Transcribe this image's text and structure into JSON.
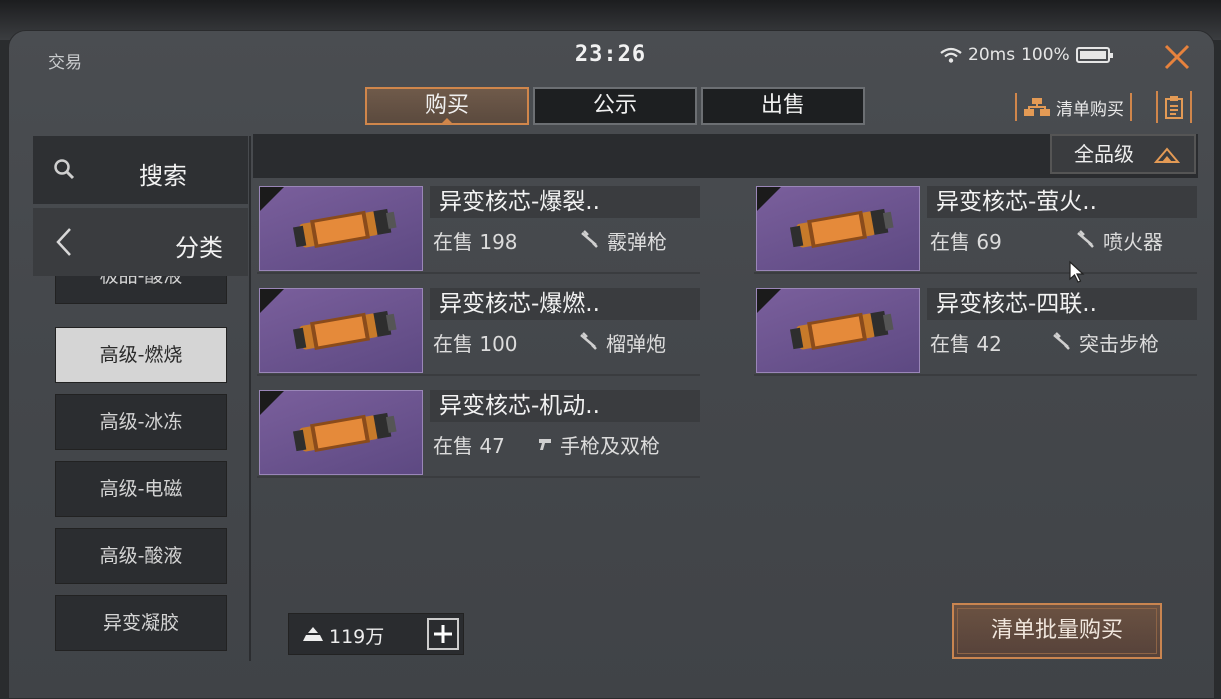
{
  "status": {
    "app_label": "交易",
    "time": "23:26",
    "network": "20ms",
    "battery": "100%"
  },
  "tabs": [
    {
      "label": "购买",
      "active": true
    },
    {
      "label": "公示",
      "active": false
    },
    {
      "label": "出售",
      "active": false
    }
  ],
  "toolbar": {
    "list_buy_label": "清单购买"
  },
  "sidebar": {
    "search_label": "搜索",
    "category_label": "分类",
    "categories": [
      {
        "label": "极品-酸液",
        "selected": false
      },
      {
        "label": "高级-燃烧",
        "selected": true
      },
      {
        "label": "高级-冰冻",
        "selected": false
      },
      {
        "label": "高级-电磁",
        "selected": false
      },
      {
        "label": "高级-酸液",
        "selected": false
      },
      {
        "label": "异变凝胶",
        "selected": false
      }
    ]
  },
  "filter": {
    "grade_label": "全品级"
  },
  "items": [
    {
      "name": "异变核芯-爆裂..",
      "stock": "在售 198",
      "weapon": "霰弹枪"
    },
    {
      "name": "异变核芯-萤火..",
      "stock": "在售 69",
      "weapon": "喷火器"
    },
    {
      "name": "异变核芯-爆燃..",
      "stock": "在售 100",
      "weapon": "榴弹炮"
    },
    {
      "name": "异变核芯-四联..",
      "stock": "在售 42",
      "weapon": "突击步枪"
    },
    {
      "name": "异变核芯-机动..",
      "stock": "在售 47",
      "weapon": "手枪及双枪"
    }
  ],
  "wallet": {
    "balance": "119万"
  },
  "actions": {
    "bulk_buy_label": "清单批量购买"
  },
  "colors": {
    "accent": "#d0864b",
    "item_bg": "#6c5490",
    "panel": "#45484c"
  }
}
